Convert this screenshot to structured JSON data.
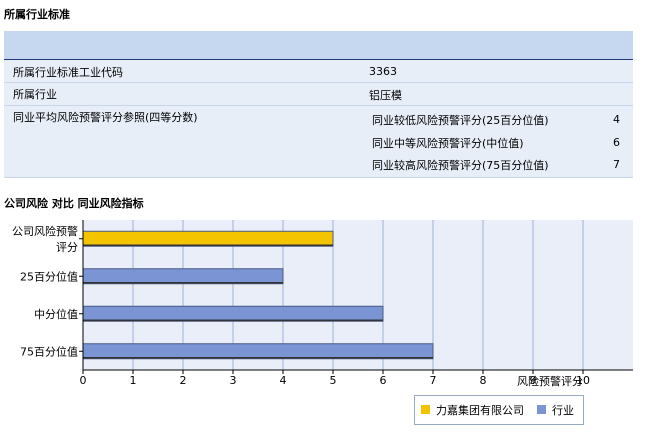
{
  "section1": {
    "title": "所属行业标准"
  },
  "rows": {
    "code_label": "所属行业标准工业代码",
    "code_value": "3363",
    "industry_label": "所属行业",
    "industry_value": "铝压模",
    "avg_label": "同业平均风险预警评分参照(四等分数)",
    "items": [
      {
        "label": "同业较低风险预警评分(25百分位值)",
        "value": "4"
      },
      {
        "label": "同业中等风险预警评分(中位值)",
        "value": "6"
      },
      {
        "label": "同业较高风险预警评分(75百分位值)",
        "value": "7"
      }
    ]
  },
  "section2": {
    "title": "公司风险 对比 同业风险指标"
  },
  "chart_data": {
    "type": "bar",
    "orientation": "horizontal",
    "categories": [
      "公司风险预警评分",
      "25百分位值",
      "中分位值",
      "75百分位值"
    ],
    "values": [
      5,
      4,
      6,
      7
    ],
    "bar_series": [
      "力嘉集团有限公司",
      "行业",
      "行业",
      "行业"
    ],
    "series": [
      {
        "name": "力嘉集团有限公司",
        "color": "#f5c400"
      },
      {
        "name": "行业",
        "color": "#7b95d4"
      }
    ],
    "xlim": [
      0,
      11
    ],
    "xticks": [
      0,
      1,
      2,
      3,
      4,
      5,
      6,
      7,
      8,
      9,
      10
    ],
    "xlabel": "风险预警评分",
    "grid": true,
    "legend_position": "bottom-right"
  }
}
